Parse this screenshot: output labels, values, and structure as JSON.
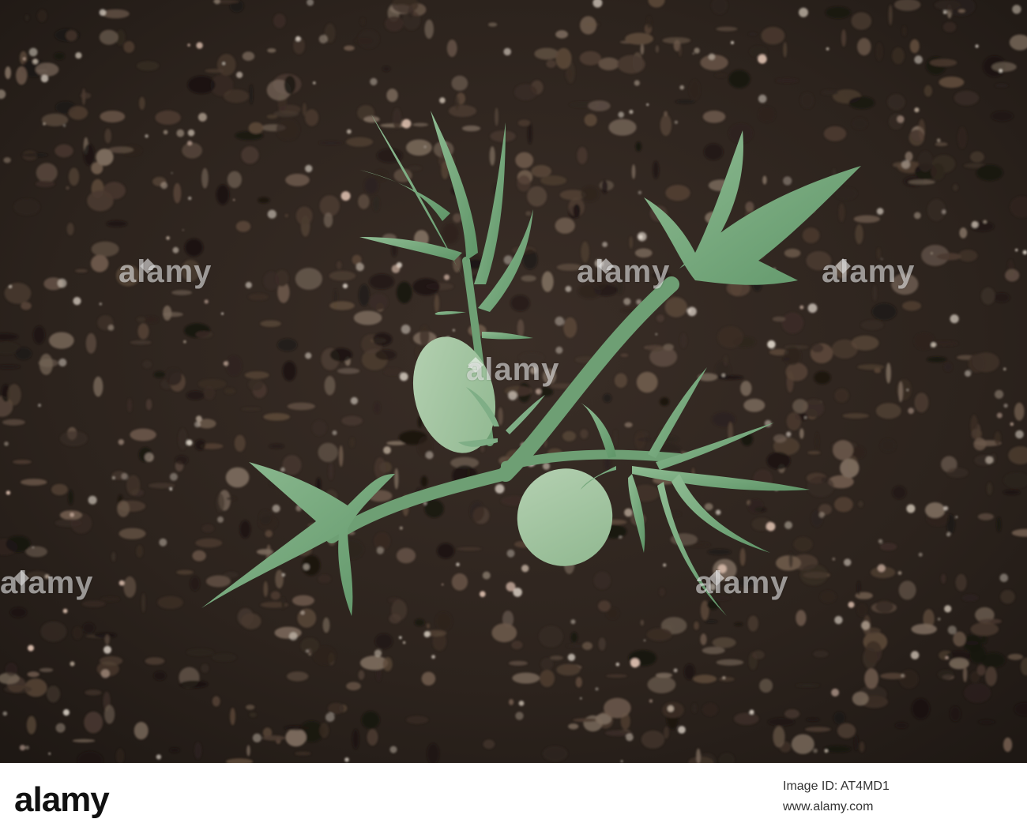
{
  "watermark": {
    "text": "alamy",
    "color": "#ffffff"
  },
  "footer": {
    "logo_text": "alamy",
    "image_id": "Image ID: AT4MD1",
    "url": "www.alamy.com"
  },
  "colors": {
    "soil_dark": "#2a211b",
    "soil_mid": "#4a3a30",
    "leaf_green": "#7fae86",
    "leaf_light": "#a8c8a9",
    "stem_green": "#6e9f74"
  }
}
